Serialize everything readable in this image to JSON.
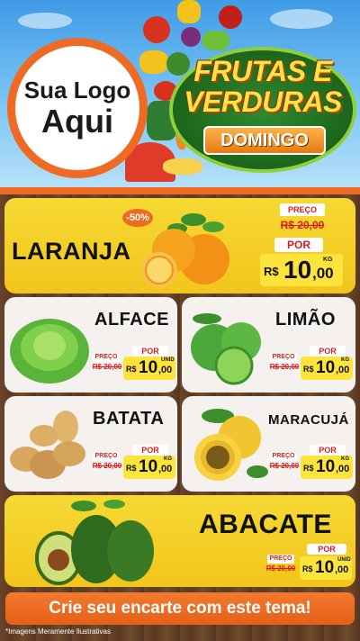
{
  "header": {
    "logo_line1": "Sua Logo",
    "logo_line2": "Aqui",
    "title_line1": "FRUTAS E",
    "title_line2": "VERDURAS",
    "day": "DOMINGO"
  },
  "currency": "R$",
  "labels": {
    "preco": "PREÇO",
    "por": "POR"
  },
  "products": [
    {
      "name": "LARANJA",
      "discount": "-50%",
      "old_price": "R$ 20,00",
      "new_int": "10",
      "new_dec": ",00",
      "unit": "KG"
    },
    {
      "name": "ALFACE",
      "old_price": "R$ 20,00",
      "new_int": "10",
      "new_dec": ",00",
      "unit": "UNID"
    },
    {
      "name": "LIMÃO",
      "old_price": "R$ 20,00",
      "new_int": "10",
      "new_dec": ",00",
      "unit": "KG"
    },
    {
      "name": "BATATA",
      "old_price": "R$ 20,00",
      "new_int": "10",
      "new_dec": ",00",
      "unit": "KG"
    },
    {
      "name": "MARACUJÁ",
      "old_price": "R$ 20,00",
      "new_int": "10",
      "new_dec": ",00",
      "unit": "KG"
    },
    {
      "name": "ABACATE",
      "old_price": "R$ 20,00",
      "new_int": "10",
      "new_dec": ",00",
      "unit": "UNID"
    }
  ],
  "cta": "Crie seu encarte com este tema!",
  "disclaimer": "*Imagens Meramente Ilustrativas",
  "colors": {
    "orange": "#ef6a22",
    "yellow": "#f6d933",
    "green": "#1e6b1e",
    "red": "#d81e1e"
  }
}
